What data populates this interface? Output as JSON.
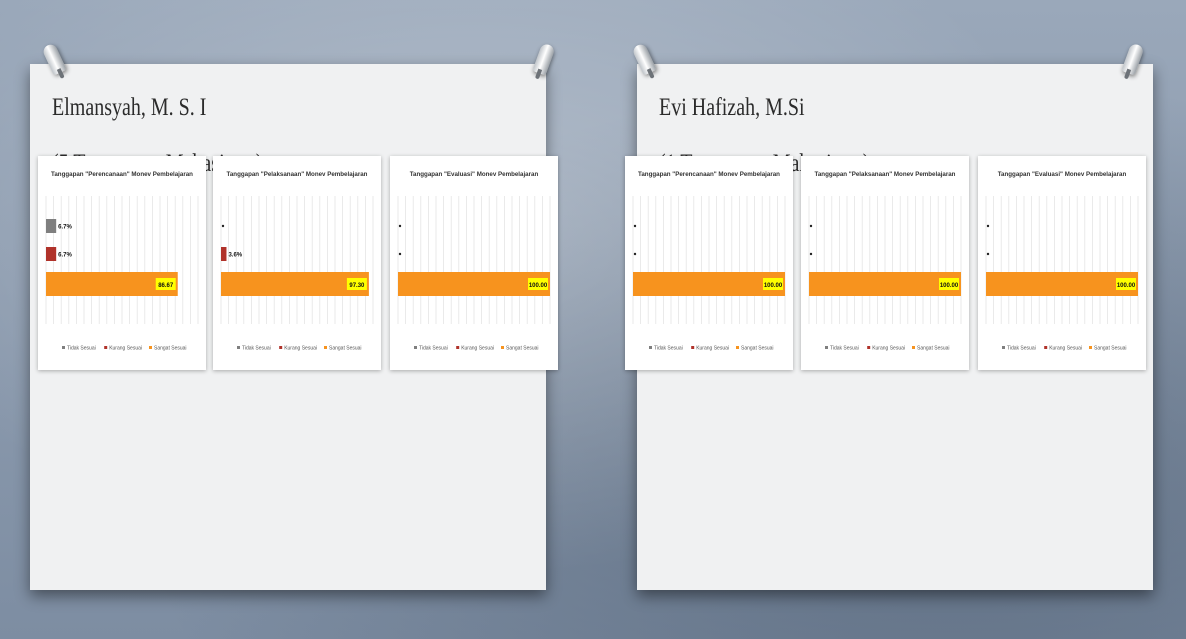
{
  "panels": [
    {
      "name": "Elmansyah, M. S. I",
      "responses": "(5 Tanggapan Mahasiswa)"
    },
    {
      "name": "Evi Hafizah, M.Si",
      "responses": "(1 Tanggapan Mahasiswa)"
    }
  ],
  "colors": {
    "tidak_sesuai": "#7f7f7f",
    "kurang_sesuai": "#b0322a",
    "sangat_sesuai": "#f7931e",
    "label_bg": "#ffff00"
  },
  "chart_data": [
    {
      "type": "bar",
      "orientation": "horizontal",
      "title": "Tanggapan \"Perencanaan\" Monev Pembelajaran",
      "categories": [
        "Tidak Sesuai",
        "Kurang Sesuai",
        "Sangat Sesuai"
      ],
      "values": [
        6.7,
        6.7,
        86.67
      ],
      "data_labels": [
        "6.7%",
        "6.7%",
        "86.67"
      ],
      "legend": [
        "Tidak Sesuai",
        "Kurang Sesuai",
        "Sangat Sesuai"
      ],
      "legend_position": "bottom",
      "xlim": [
        0,
        100
      ]
    },
    {
      "type": "bar",
      "orientation": "horizontal",
      "title": "Tanggapan \"Pelaksanaan\" Monev Pembelajaran",
      "categories": [
        "Tidak Sesuai",
        "Kurang Sesuai",
        "Sangat Sesuai"
      ],
      "values": [
        0,
        3.6,
        97.3
      ],
      "data_labels": [
        "",
        "3.6%",
        "97.30"
      ],
      "legend": [
        "Tidak Sesuai",
        "Kurang Sesuai",
        "Sangat Sesuai"
      ],
      "legend_position": "bottom",
      "xlim": [
        0,
        100
      ]
    },
    {
      "type": "bar",
      "orientation": "horizontal",
      "title": "Tanggapan \"Evaluasi\" Monev Pembelajaran",
      "categories": [
        "Tidak Sesuai",
        "Kurang Sesuai",
        "Sangat Sesuai"
      ],
      "values": [
        0,
        0,
        100
      ],
      "data_labels": [
        "",
        "",
        "100.00"
      ],
      "legend": [
        "Tidak Sesuai",
        "Kurang Sesuai",
        "Sangat Sesuai"
      ],
      "legend_position": "bottom",
      "xlim": [
        0,
        100
      ]
    },
    {
      "type": "bar",
      "orientation": "horizontal",
      "title": "Tanggapan \"Perencanaan\" Monev Pembelajaran",
      "categories": [
        "Tidak Sesuai",
        "Kurang Sesuai",
        "Sangat Sesuai"
      ],
      "values": [
        0,
        0,
        100
      ],
      "data_labels": [
        "",
        "",
        "100.00"
      ],
      "legend": [
        "Tidak Sesuai",
        "Kurang Sesuai",
        "Sangat Sesuai"
      ],
      "legend_position": "bottom",
      "xlim": [
        0,
        100
      ]
    },
    {
      "type": "bar",
      "orientation": "horizontal",
      "title": "Tanggapan \"Pelaksanaan\" Monev Pembelajaran",
      "categories": [
        "Tidak Sesuai",
        "Kurang Sesuai",
        "Sangat Sesuai"
      ],
      "values": [
        0,
        0,
        100
      ],
      "data_labels": [
        "",
        "",
        "100.00"
      ],
      "legend": [
        "Tidak Sesuai",
        "Kurang Sesuai",
        "Sangat Sesuai"
      ],
      "legend_position": "bottom",
      "xlim": [
        0,
        100
      ]
    },
    {
      "type": "bar",
      "orientation": "horizontal",
      "title": "Tanggapan \"Evaluasi\" Monev Pembelajaran",
      "categories": [
        "Tidak Sesuai",
        "Kurang Sesuai",
        "Sangat Sesuai"
      ],
      "values": [
        0,
        0,
        100
      ],
      "data_labels": [
        "",
        "",
        "100.00"
      ],
      "legend": [
        "Tidak Sesuai",
        "Kurang Sesuai",
        "Sangat Sesuai"
      ],
      "legend_position": "bottom",
      "xlim": [
        0,
        100
      ]
    }
  ]
}
